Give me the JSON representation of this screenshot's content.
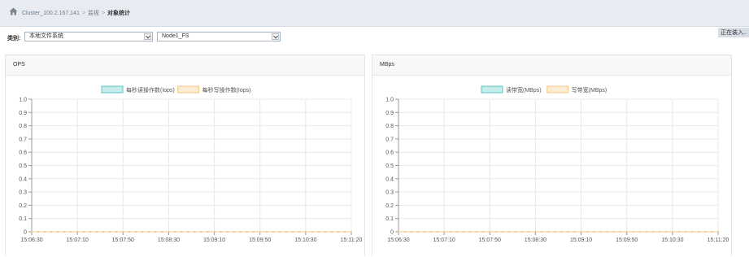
{
  "breadcrumb": {
    "items": [
      "Cluster_100.2.167.141",
      "监视"
    ],
    "current": "对象统计",
    "separator": ">"
  },
  "filter": {
    "label": "类别:",
    "category_value": "本地文件系统",
    "node_value": "Node1_FS"
  },
  "loading_text": "正在装入..",
  "colors": {
    "series1": "#5cc7c7",
    "series2": "#f5c686",
    "grid": "#e8e8e8",
    "axis": "#999999"
  },
  "panels": [
    {
      "title": "OPS",
      "legend": [
        "每秒读操作数(Iops)",
        "每秒写操作数(Iops)"
      ]
    },
    {
      "title": "MBps",
      "legend": [
        "读带宽(MBps)",
        "写带宽(MBps)"
      ]
    }
  ],
  "chart_data": [
    {
      "type": "line",
      "title": "OPS",
      "x": [
        "15:06:30",
        "15:07:10",
        "15:07:50",
        "15:08:30",
        "15:09:10",
        "15:09:50",
        "15:10:30",
        "15:11:20"
      ],
      "yticks": [
        "1.0",
        "0.9",
        "0.8",
        "0.7",
        "0.6",
        "0.5",
        "0.4",
        "0.3",
        "0.2",
        "0.1",
        "0"
      ],
      "ylim": [
        0,
        1.0
      ],
      "grid": true,
      "legend_position": "top-center",
      "points_per_series": 50,
      "series": [
        {
          "name": "每秒读操作数(Iops)",
          "value": 0
        },
        {
          "name": "每秒写操作数(Iops)",
          "value": 0
        }
      ]
    },
    {
      "type": "line",
      "title": "MBps",
      "x": [
        "15:06:30",
        "15:07:10",
        "15:07:50",
        "15:08:30",
        "15:09:10",
        "15:09:50",
        "15:10:30",
        "15:11:20"
      ],
      "yticks": [
        "1.0",
        "0.9",
        "0.8",
        "0.7",
        "0.6",
        "0.5",
        "0.4",
        "0.3",
        "0.2",
        "0.1",
        "0"
      ],
      "ylim": [
        0,
        1.0
      ],
      "grid": true,
      "legend_position": "top-center",
      "points_per_series": 50,
      "series": [
        {
          "name": "读带宽(MBps)",
          "value": 0
        },
        {
          "name": "写带宽(MBps)",
          "value": 0
        }
      ]
    }
  ]
}
